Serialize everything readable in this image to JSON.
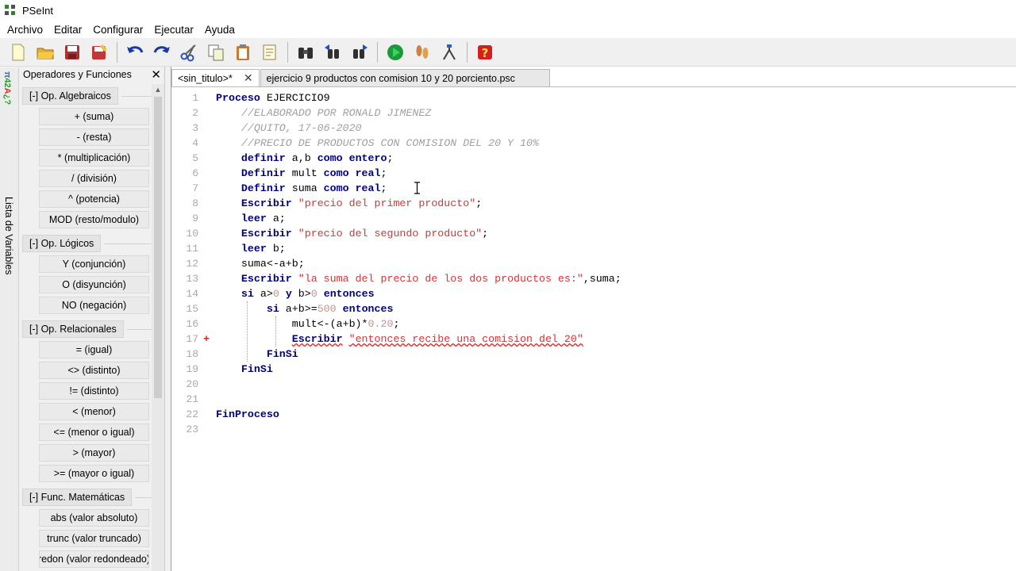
{
  "window": {
    "title": "PSeInt"
  },
  "menu": [
    "Archivo",
    "Editar",
    "Configurar",
    "Ejecutar",
    "Ayuda"
  ],
  "toolbar": [
    "new-file-icon",
    "open-folder-icon",
    "save-icon",
    "save-as-icon",
    "undo-icon",
    "redo-icon",
    "cut-icon",
    "copy-icon",
    "paste-icon",
    "edit-icon",
    "find-icon",
    "find-previous-icon",
    "find-next-icon",
    "run-icon",
    "step-by-step-icon",
    "flowchart-icon",
    "help-icon"
  ],
  "side_tab": {
    "label": "Lista de Variables"
  },
  "panel": {
    "title": "Operadores y Funciones",
    "groups": [
      {
        "label": "[-]  Op. Algebraicos",
        "items": [
          "+ (suma)",
          "- (resta)",
          "* (multiplicación)",
          "/ (división)",
          "^ (potencia)",
          "MOD (resto/modulo)"
        ]
      },
      {
        "label": "[-]  Op. Lógicos",
        "items": [
          "Y (conjunción)",
          "O (disyunción)",
          "NO (negación)"
        ]
      },
      {
        "label": "[-]  Op. Relacionales",
        "items": [
          "= (igual)",
          "<> (distinto)",
          "!= (distinto)",
          "< (menor)",
          "<= (menor o igual)",
          "> (mayor)",
          ">= (mayor o igual)"
        ]
      },
      {
        "label": "[-]  Func. Matemáticas",
        "items": [
          "abs (valor absoluto)",
          "trunc (valor truncado)",
          "redon (valor redondeado)"
        ]
      }
    ]
  },
  "tabs": [
    {
      "label": "<sin_titulo>*",
      "active": true
    },
    {
      "label": "ejercicio 9 productos con comision 10 y 20 porciento.psc",
      "active": false
    }
  ],
  "code_lines": [
    {
      "n": "1",
      "text": "Proceso EJERCICIO9"
    },
    {
      "n": "2",
      "text": "    //ELABORADO POR RONALD JIMENEZ"
    },
    {
      "n": "3",
      "text": "    //QUITO, 17-06-2020"
    },
    {
      "n": "4",
      "text": "    //PRECIO DE PRODUCTOS CON COMISION DEL 20 Y 10%"
    },
    {
      "n": "5",
      "text": "    definir a,b como entero;"
    },
    {
      "n": "6",
      "text": "    Definir mult como real;"
    },
    {
      "n": "7",
      "text": "    Definir suma como real;"
    },
    {
      "n": "8",
      "text": "    Escribir \"precio del primer producto\";"
    },
    {
      "n": "9",
      "text": "    leer a;"
    },
    {
      "n": "10",
      "text": "    Escribir \"precio del segundo producto\";"
    },
    {
      "n": "11",
      "text": "    leer b;"
    },
    {
      "n": "12",
      "text": "    suma<-a+b;"
    },
    {
      "n": "13",
      "text": "    Escribir \"la suma del precio de los dos productos es:\",suma;"
    },
    {
      "n": "14",
      "text": "    si a>0 y b>0 entonces"
    },
    {
      "n": "15",
      "text": "        si a+b>=500 entonces"
    },
    {
      "n": "16",
      "text": "            mult<-(a+b)*0.20;"
    },
    {
      "n": "17",
      "text": "            Escribir \"entonces recibe una comision del 20\""
    },
    {
      "n": "18",
      "text": "        FinSi"
    },
    {
      "n": "19",
      "text": "    FinSi"
    },
    {
      "n": "20",
      "text": ""
    },
    {
      "n": "21",
      "text": ""
    },
    {
      "n": "22",
      "text": "FinProceso"
    },
    {
      "n": "23",
      "text": ""
    }
  ],
  "error_marker": "+"
}
